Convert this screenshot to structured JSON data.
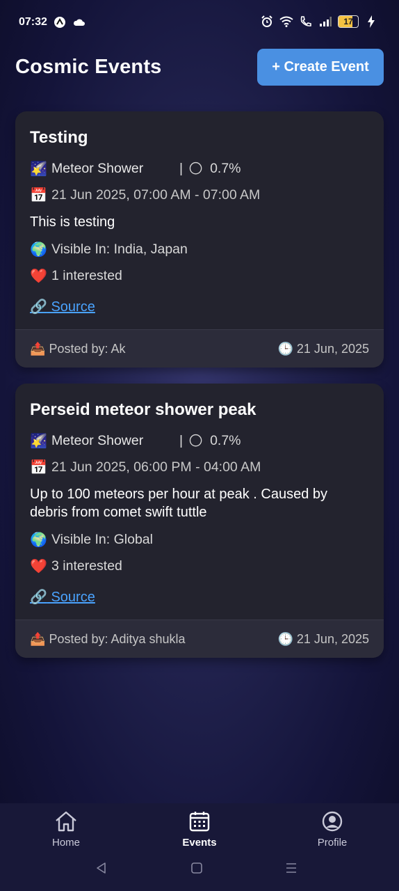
{
  "status_bar": {
    "time": "07:32",
    "battery": "17"
  },
  "header": {
    "title": "Cosmic Events",
    "create_button": "+ Create Event"
  },
  "events": [
    {
      "title": "Testing",
      "type_emoji": "🌠",
      "type": "Meteor Shower",
      "separator": "|",
      "moon_emoji": "🌕",
      "moon": "0.7%",
      "date_emoji": "📅",
      "date": "21 Jun 2025, 07:00 AM - 07:00 AM",
      "description": "This is testing",
      "visible_emoji": "🌍",
      "visible": "Visible In: India, Japan",
      "interest_emoji": "❤️",
      "interested": "1 interested",
      "source_emoji": "🔗",
      "source": "Source",
      "posted_emoji": "📤",
      "posted_by": "Posted by: Ak",
      "clock_emoji": "🕒",
      "posted_date": "21 Jun, 2025"
    },
    {
      "title": "Perseid meteor shower peak",
      "type_emoji": "🌠",
      "type": "Meteor Shower",
      "separator": "|",
      "moon_emoji": "🌕",
      "moon": "0.7%",
      "date_emoji": "📅",
      "date": "21 Jun 2025, 06:00 PM - 04:00 AM",
      "description": "Up to 100 meteors per hour at peak . Caused by debris from comet swift tuttle",
      "visible_emoji": "🌍",
      "visible": "Visible In: Global",
      "interest_emoji": "❤️",
      "interested": "3 interested",
      "source_emoji": "🔗",
      "source": "Source",
      "posted_emoji": "📤",
      "posted_by": "Posted by: Aditya shukla",
      "clock_emoji": "🕒",
      "posted_date": "21 Jun, 2025"
    }
  ],
  "nav": {
    "home": "Home",
    "events": "Events",
    "profile": "Profile"
  },
  "colors": {
    "accent": "#4a90e2",
    "link": "#4aa3ff",
    "card": "#23232e",
    "nav_bg": "#181838"
  }
}
